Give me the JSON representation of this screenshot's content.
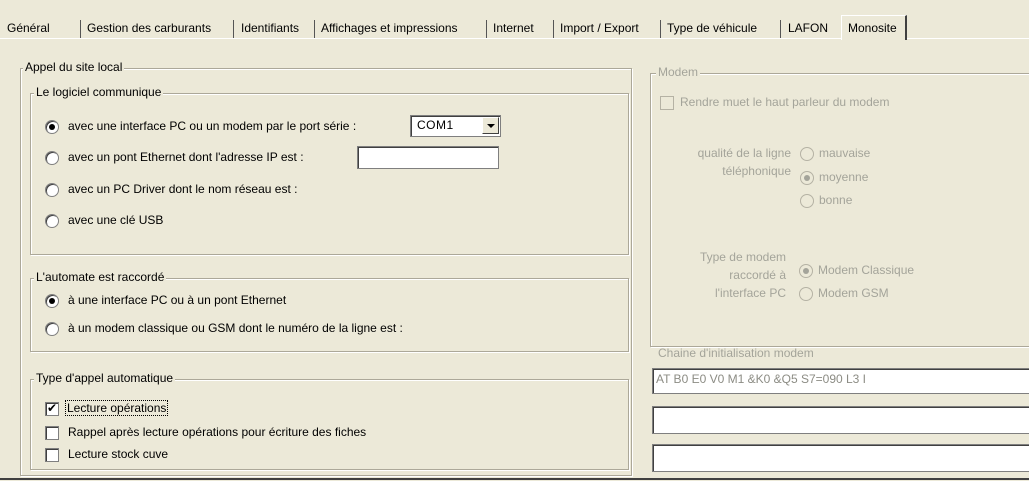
{
  "tabs": [
    {
      "label": "Général"
    },
    {
      "label": "Gestion des carburants"
    },
    {
      "label": "Identifiants"
    },
    {
      "label": "Affichages et impressions"
    },
    {
      "label": "Internet"
    },
    {
      "label": "Import / Export"
    },
    {
      "label": "Type de véhicule"
    },
    {
      "label": "LAFON"
    },
    {
      "label": "Monosite"
    }
  ],
  "active_tab": "Monosite",
  "local_call": {
    "title": "Appel du site local",
    "software": {
      "title": "Le logiciel communique",
      "options": [
        {
          "label": "avec une interface PC ou un modem par le port série :",
          "checked": true
        },
        {
          "label": "avec un pont Ethernet dont l'adresse IP est :",
          "checked": false
        },
        {
          "label": "avec un PC Driver dont le nom réseau est :",
          "checked": false
        },
        {
          "label": "avec une clé USB",
          "checked": false
        }
      ],
      "port_value": "COM1",
      "ip_value": ""
    },
    "automate": {
      "title": "L'automate est raccordé",
      "options": [
        {
          "label": "à une interface PC ou à un pont Ethernet",
          "checked": true
        },
        {
          "label": "à un modem classique ou GSM dont le numéro de la ligne est :",
          "checked": false
        }
      ]
    },
    "auto_call": {
      "title": "Type d'appel automatique",
      "options": [
        {
          "label": "Lecture opérations",
          "checked": true
        },
        {
          "label": "Rappel après lecture opérations pour écriture des fiches",
          "checked": false
        },
        {
          "label": "Lecture stock cuve",
          "checked": false
        }
      ]
    }
  },
  "modem": {
    "title": "Modem",
    "mute_label": "Rendre muet le haut parleur du modem",
    "line_quality_label_1": "qualité de la ligne",
    "line_quality_label_2": "téléphonique",
    "line_quality_options": [
      {
        "label": "mauvaise",
        "checked": false
      },
      {
        "label": "moyenne",
        "checked": true
      },
      {
        "label": "bonne",
        "checked": false
      }
    ],
    "modem_type_label_1": "Type de modem",
    "modem_type_label_2": "raccordé à",
    "modem_type_label_3": "l'interface PC",
    "modem_type_options": [
      {
        "label": "Modem Classique",
        "checked": true
      },
      {
        "label": "Modem GSM",
        "checked": false
      }
    ],
    "init_string_label": "Chaine d'initialisation modem",
    "init_string_value": "AT B0 E0 V0 M1 &K0 &Q5 S7=090 L3 I",
    "extra_field_1": "",
    "extra_field_2": ""
  }
}
